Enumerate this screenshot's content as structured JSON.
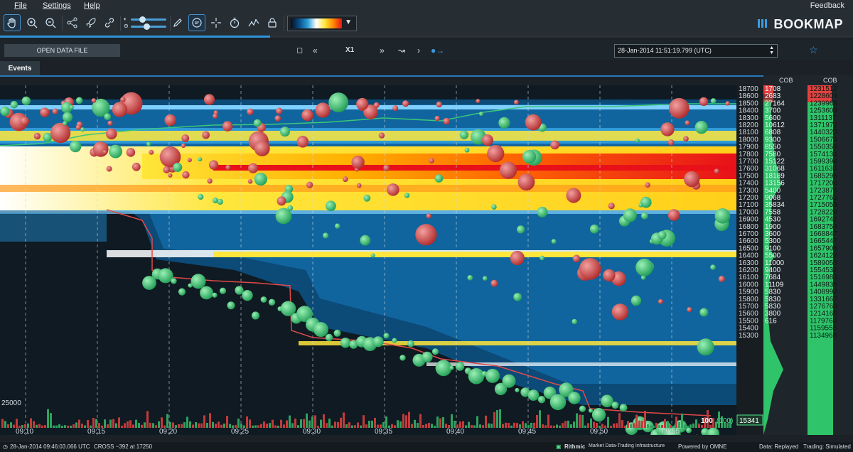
{
  "menu": {
    "file": "File",
    "settings": "Settings",
    "help": "Help",
    "feedback": "Feedback"
  },
  "brand": {
    "name": "BOOKMAP"
  },
  "toolbar": {
    "tools": [
      "hand-icon",
      "zoom-in-icon",
      "zoom-out-icon",
      "share-icon",
      "rocket-icon",
      "link-icon",
      "pencil-icon",
      "chat-icon",
      "crosshair-icon",
      "timer-icon",
      "chart-line-icon",
      "lock-icon"
    ],
    "heatmap_gradient": [
      "#05101f",
      "#0b4f88",
      "#2a9fd6",
      "#ffffff",
      "#ffe63a",
      "#ff8a00",
      "#e8111a"
    ]
  },
  "replay": {
    "open_label": "OPEN DATA FILE",
    "speed": "X1",
    "datetime": "28-Jan-2014 11:51:19.799 (UTC)"
  },
  "tabs": {
    "events": "Events"
  },
  "price_axis": [
    "18700",
    "18600",
    "18500",
    "18400",
    "18300",
    "18200",
    "18100",
    "18000",
    "17900",
    "17800",
    "17700",
    "17600",
    "17500",
    "17400",
    "17300",
    "17200",
    "17100",
    "17000",
    "16900",
    "16800",
    "16700",
    "16600",
    "16500",
    "16400",
    "16300",
    "16200",
    "16100",
    "16000",
    "15900",
    "15800",
    "15700",
    "15600",
    "15500",
    "15400",
    "15300"
  ],
  "current_price": "15341",
  "time_axis": [
    "09:10",
    "09:15",
    "09:20",
    "09:25",
    "09:30",
    "09:35",
    "09:40",
    "09:45",
    "09:50",
    "09:55"
  ],
  "volume_axis_label": "25000",
  "last_trade": "100",
  "last_trade_paren": "(100)",
  "cob_header": "COB",
  "cob_left": [
    "1708",
    "2683",
    "27164",
    "3700",
    "5600",
    "10612",
    "6808",
    "9300",
    "8550",
    "7580",
    "15122",
    "31068",
    "18189",
    "13156",
    "5400",
    "9068",
    "35834",
    "7558",
    "4530",
    "1900",
    "3600",
    "5300",
    "9100",
    "5500",
    "11000",
    "9400",
    "7684",
    "11109",
    "5830",
    "5830",
    "5830",
    "3800",
    "616"
  ],
  "cob_right": [
    "1231512",
    "1228604",
    "1239968",
    "1253603",
    "1311137",
    "1371972",
    "1440323",
    "1506674",
    "1550356",
    "1574134",
    "1599394",
    "1611633",
    "1685295",
    "1717206",
    "1723875",
    "1727763",
    "1715053",
    "1728228",
    "1692742",
    "1683754",
    "1668847",
    "1665447",
    "1657906",
    "1624122",
    "1589053",
    "1554532",
    "1516983",
    "1449839",
    "1408992",
    "1331662",
    "1276769",
    "1214160",
    "1179760",
    "1159555",
    "1134968"
  ],
  "status": {
    "time": "28-Jan-2014 09:46:03.066 UTC",
    "cross": "CROSS ~392 at 17250",
    "rithmic": "Rithmic",
    "rithmic_tag": "Market Data-Trading Infrastructure",
    "omne": "Powered by OMNE",
    "data": "Data: Replayed",
    "trading": "Trading: Simulated"
  }
}
